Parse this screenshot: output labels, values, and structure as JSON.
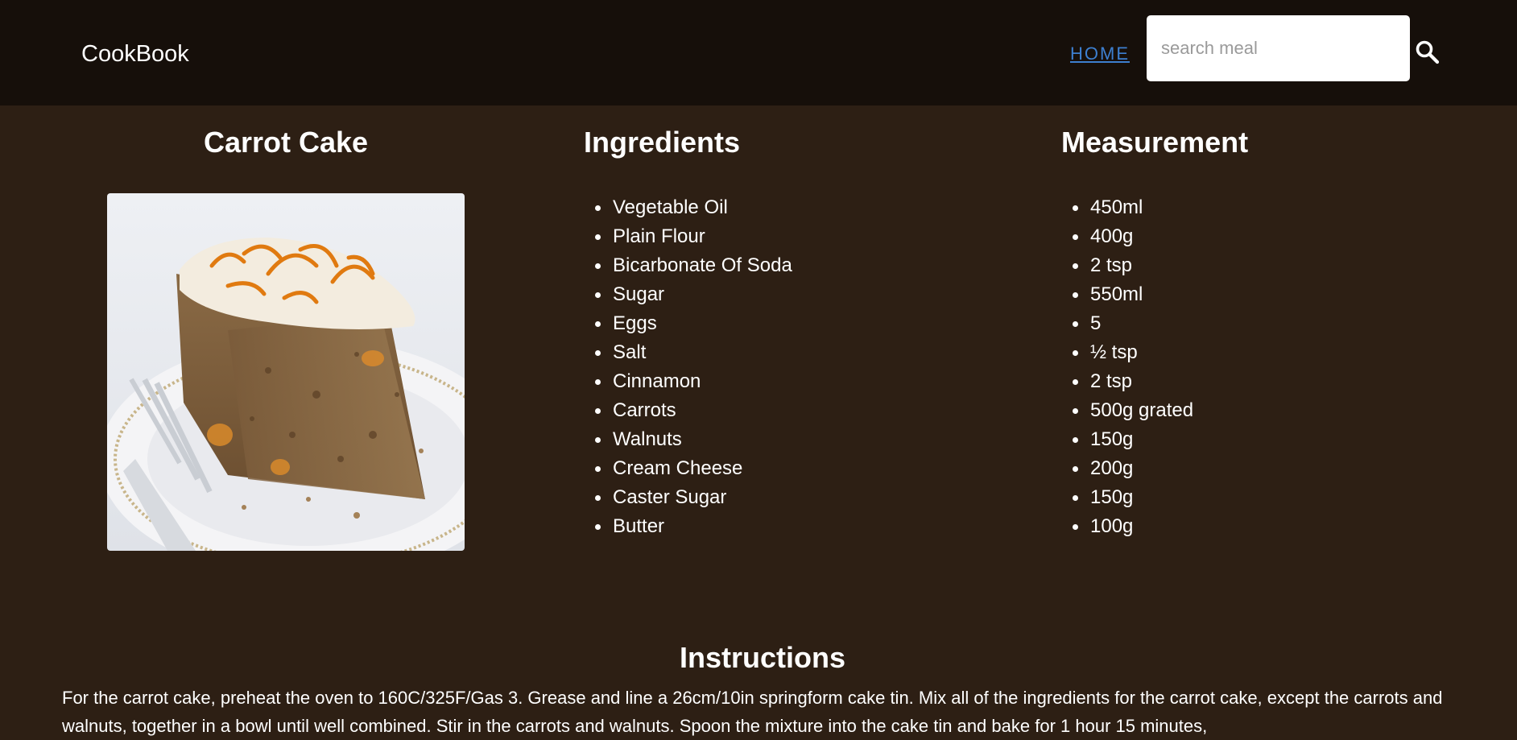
{
  "header": {
    "brand": "CookBook",
    "nav_home": "HOME",
    "search_placeholder": "search meal",
    "search_icon": "search-icon"
  },
  "recipe": {
    "title": "Carrot Cake",
    "image": "carrot-cake-photo",
    "ingredients_heading": "Ingredients",
    "measurement_heading": "Measurement",
    "ingredients": [
      "Vegetable Oil",
      "Plain Flour",
      "Bicarbonate Of Soda",
      "Sugar",
      "Eggs",
      "Salt",
      "Cinnamon",
      "Carrots",
      "Walnuts",
      "Cream Cheese",
      "Caster Sugar",
      "Butter"
    ],
    "measurements": [
      "450ml",
      "400g",
      "2 tsp",
      "550ml",
      "5",
      "½ tsp",
      "2 tsp",
      "500g grated",
      "150g",
      "200g",
      "150g",
      "100g"
    ],
    "instructions_heading": "Instructions",
    "instructions": "For the carrot cake, preheat the oven to 160C/325F/Gas 3. Grease and line a 26cm/10in springform cake tin. Mix all of the ingredients for the carrot cake, except the carrots and walnuts, together in a bowl until well combined. Stir in the carrots and walnuts. Spoon the mixture into the cake tin and bake for 1 hour 15 minutes,"
  }
}
